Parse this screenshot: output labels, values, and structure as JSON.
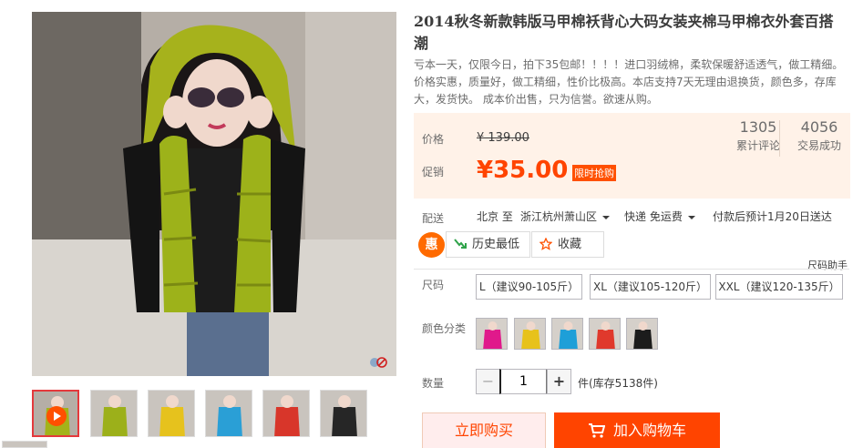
{
  "product": {
    "title": "2014秋冬新款韩版马甲棉袄背心大码女装夹棉马甲棉衣外套百搭潮",
    "subtitle": "亏本一天，仅限今日，拍下35包邮！！！！进口羽绒棉，柔软保暖舒适透气，做工精细。价格实惠，质量好，做工精细，性价比极高。本店支持7天无理由退换货，颜色多，存库大，发货快。 成本价出售，只为信誉。欲速从购。"
  },
  "price": {
    "label_price": "价格",
    "original": "¥ 139.00",
    "label_promo": "促销",
    "promo": "¥35.00",
    "promo_tag": "限时抢购"
  },
  "stats": {
    "reviews_count": "1305",
    "reviews_label": "累计评论",
    "sales_count": "4056",
    "sales_label": "交易成功"
  },
  "shipping": {
    "label": "配送",
    "from": "北京 至",
    "to": "浙江杭州萧山区",
    "method": "快递 免运费",
    "eta": "付款后预计1月20日送达"
  },
  "actions": {
    "hui": "惠",
    "history_low": "历史最低",
    "favorite": "收藏",
    "size_help": "尺码助手"
  },
  "sizes": {
    "label": "尺码",
    "options": [
      "L（建议90-105斤）",
      "XL（建议105-120斤）",
      "XXL（建议120-135斤）"
    ]
  },
  "colors": {
    "label": "颜色分类",
    "swatches": [
      "#e0198b",
      "#e7c21b",
      "#1e9fd8",
      "#e0392c",
      "#1c1c1c"
    ]
  },
  "quantity": {
    "label": "数量",
    "minus": "−",
    "value": "1",
    "plus": "+",
    "stock": "件(库存5138件)"
  },
  "buttons": {
    "buy_now": "立即购买",
    "add_to_cart": "加入购物车"
  },
  "thumbnails": {
    "vest_colors": [
      "#a3b31a",
      "#9cb01a",
      "#e6c21d",
      "#2a9fd6",
      "#d8362a",
      "#262626"
    ]
  },
  "theme": {
    "accent": "#ff4400",
    "promo_bg": "#fff2e8"
  }
}
